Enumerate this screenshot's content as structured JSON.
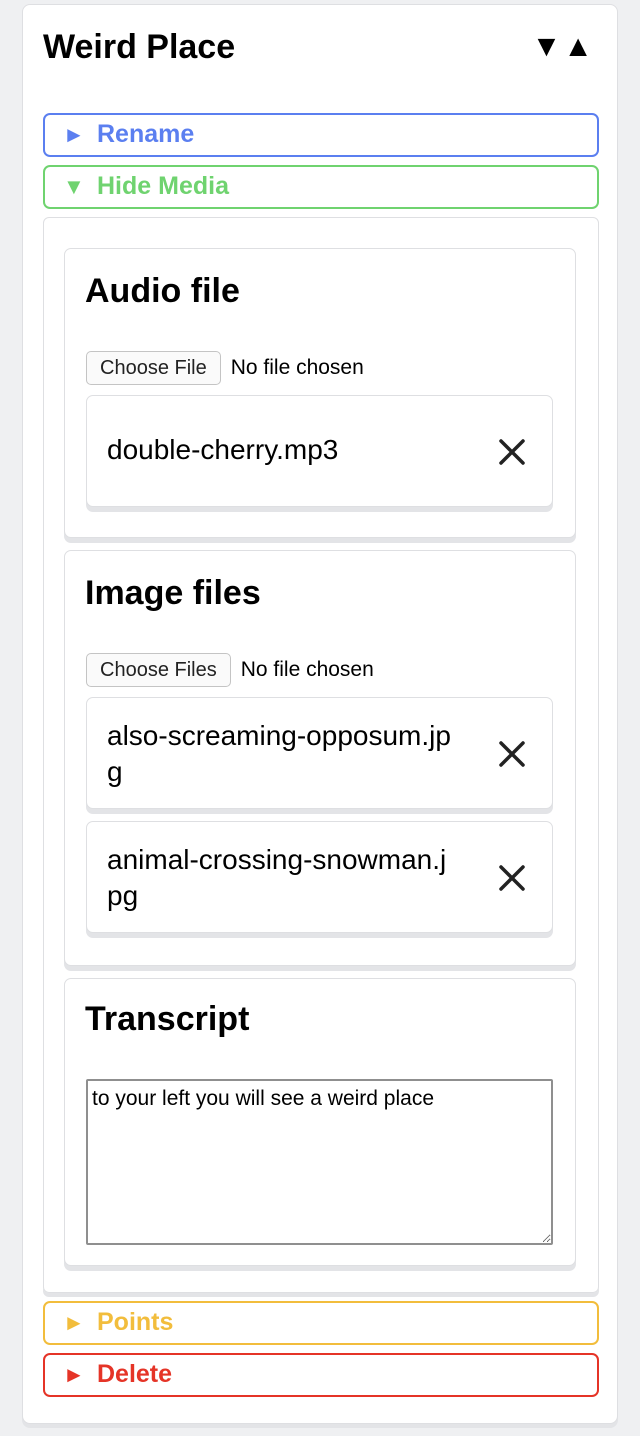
{
  "place": {
    "title": "Weird Place",
    "move_down_icon": "▼",
    "move_up_icon": "▲"
  },
  "toggles": {
    "rename": {
      "icon": "►",
      "label": "Rename",
      "color": "#5b7ff0"
    },
    "media": {
      "icon": "▼",
      "label": "Hide Media",
      "color": "#6fd36f"
    },
    "points": {
      "icon": "►",
      "label": "Points",
      "color": "#f2bd3c"
    },
    "delete": {
      "icon": "►",
      "label": "Delete",
      "color": "#e53427"
    }
  },
  "audio": {
    "heading": "Audio file",
    "button_label": "Choose File",
    "status": "No file chosen",
    "files": [
      {
        "name": "double-cherry.mp3"
      }
    ]
  },
  "images": {
    "heading": "Image files",
    "button_label": "Choose Files",
    "status": "No file chosen",
    "files": [
      {
        "name": "also-screaming-opposum.jpg"
      },
      {
        "name": "animal-crossing-snowman.jpg"
      }
    ]
  },
  "transcript": {
    "heading": "Transcript",
    "value": "to your left you will see a weird place"
  },
  "icons": {
    "remove": "close-icon"
  }
}
